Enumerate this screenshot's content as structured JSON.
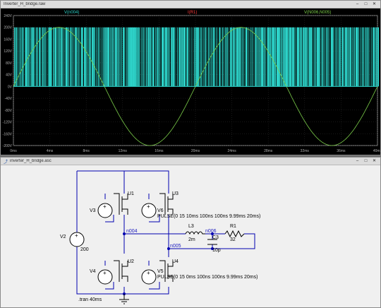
{
  "plot_window": {
    "title": "Inverter_H_bridge.raw",
    "controls": [
      "minimize",
      "maximize",
      "close"
    ]
  },
  "schematic_window": {
    "title": "inverter_H_bridge.asc",
    "controls": [
      "minimize",
      "maximize",
      "close"
    ]
  },
  "chart_data": {
    "type": "line",
    "legend": [
      {
        "name": "V(n004)",
        "color": "#2dd3c9"
      },
      {
        "name": "I(R1)",
        "color": "#ff3b3b"
      },
      {
        "name": "V(N006,N005)",
        "color": "#7ccf4a"
      }
    ],
    "y_ticks": [
      "240V",
      "200V",
      "160V",
      "120V",
      "80V",
      "40V",
      "0V",
      "-40V",
      "-80V",
      "-120V",
      "-160V",
      "-200V"
    ],
    "y_range": [
      -200,
      240
    ],
    "x_ticks": [
      "0ms",
      "4ms",
      "8ms",
      "12ms",
      "16ms",
      "20ms",
      "24ms",
      "28ms",
      "32ms",
      "36ms",
      "40ms"
    ],
    "x_range_ms": [
      0,
      40
    ],
    "series": [
      {
        "name": "V(n004)",
        "kind": "pwm",
        "low": 0,
        "high": 200
      },
      {
        "name": "V(N006,N005)",
        "kind": "sine",
        "amplitude": 200,
        "period_ms": 20,
        "offset": 0
      }
    ],
    "background": "#000000",
    "grid": true
  },
  "schematic": {
    "labels": {
      "u1": "U1",
      "u2": "U2",
      "u3": "U3",
      "u4": "U4",
      "v1": "V2",
      "v1_val": "200",
      "v3": "V3",
      "v4": "V4",
      "v6": "V6",
      "v6_val": "PULSE(0 15 10ms 100ns 100ns 9.99ms 20ms)",
      "v5": "V5",
      "v5_val": "PULSE(0 15 0ms 100ns 100ns 9.99ms 20ms)",
      "n004": "n004",
      "n005": "n005",
      "n006": "n006",
      "l3": "L3",
      "l3_val": "2m",
      "c3": "C3",
      "c3_val": "10p",
      "r1": "R1",
      "r1_val": "32",
      "directive": ".tran 40ms"
    }
  }
}
